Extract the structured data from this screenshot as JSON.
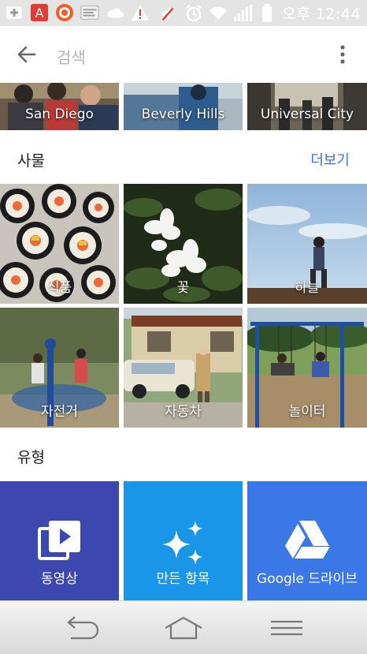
{
  "status_bar": {
    "time": "오후 12:44",
    "left_icons": [
      "plus-notification-icon",
      "app-badge-icon",
      "target-icon",
      "card-news-icon",
      "cloud-icon",
      "warning-icon"
    ],
    "right_icons": [
      "mute-icon",
      "alarm-icon",
      "wifi-icon",
      "signal-icon",
      "battery-icon"
    ]
  },
  "appbar": {
    "search_placeholder": "검색"
  },
  "places": [
    {
      "label": "San Diego"
    },
    {
      "label": "Beverly Hills"
    },
    {
      "label": "Universal City"
    }
  ],
  "things": {
    "title": "사물",
    "more": "더보기",
    "items": [
      {
        "label": "식품"
      },
      {
        "label": "꽃"
      },
      {
        "label": "하늘"
      },
      {
        "label": "자전거"
      },
      {
        "label": "자동차"
      },
      {
        "label": "놀이터"
      }
    ]
  },
  "types": {
    "title": "유형",
    "items": [
      {
        "label": "동영상",
        "color": "#3d47b0",
        "icon": "video-icon"
      },
      {
        "label": "만든 항목",
        "color": "#1a96e8",
        "icon": "sparkle-icon"
      },
      {
        "label": "Google 드라이브",
        "color": "#3b78e7",
        "icon": "drive-icon"
      }
    ]
  },
  "navbar": {
    "icons": [
      "back-nav-icon",
      "home-nav-icon",
      "menu-nav-icon"
    ]
  }
}
